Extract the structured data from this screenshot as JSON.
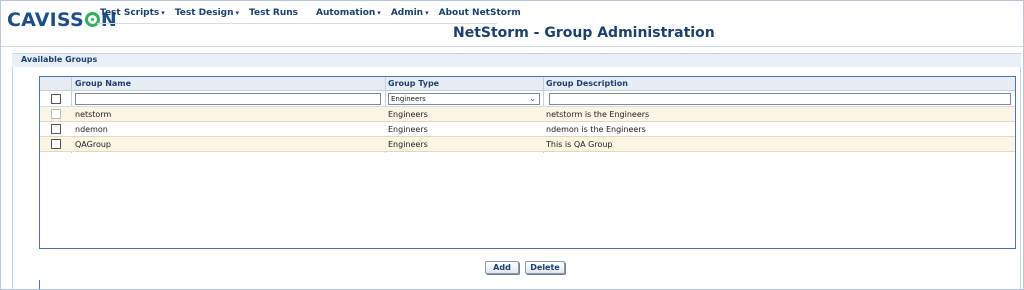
{
  "brand": {
    "logo_text_a": "CAVISS",
    "logo_text_b": "N"
  },
  "menu": [
    {
      "label": "Test Scripts",
      "caret": "▾"
    },
    {
      "label": "Test Design",
      "caret": "▾"
    },
    {
      "label": "Test Runs",
      "caret": ""
    },
    {
      "label": "Automation",
      "caret": "▾"
    },
    {
      "label": "Admin",
      "caret": "▾"
    },
    {
      "label": "About NetStorm",
      "caret": ""
    }
  ],
  "page": {
    "title": "NetStorm - Group Administration"
  },
  "section": {
    "title": "Available Groups"
  },
  "grid": {
    "headers": {
      "name": "Group Name",
      "type": "Group Type",
      "description": "Group Description"
    },
    "filter": {
      "name_value": "",
      "type_value": "Engineers",
      "description_value": ""
    },
    "rows": [
      {
        "name": "netstorm",
        "type": "Engineers",
        "description": "netstorm is the Engineers",
        "checkbox_enabled": false
      },
      {
        "name": "ndemon",
        "type": "Engineers",
        "description": "ndemon is the Engineers",
        "checkbox_enabled": true
      },
      {
        "name": "QAGroup",
        "type": "Engineers",
        "description": "This is QA Group",
        "checkbox_enabled": true
      }
    ]
  },
  "buttons": {
    "add": "Add",
    "delete": "Delete"
  },
  "icons": {
    "dropdown": "chevron-down-icon"
  },
  "colors": {
    "brand_blue": "#1b4f8f",
    "brand_green": "#2db35d",
    "title_blue": "#1b3f73",
    "row_alt": "#fbf5e3"
  }
}
